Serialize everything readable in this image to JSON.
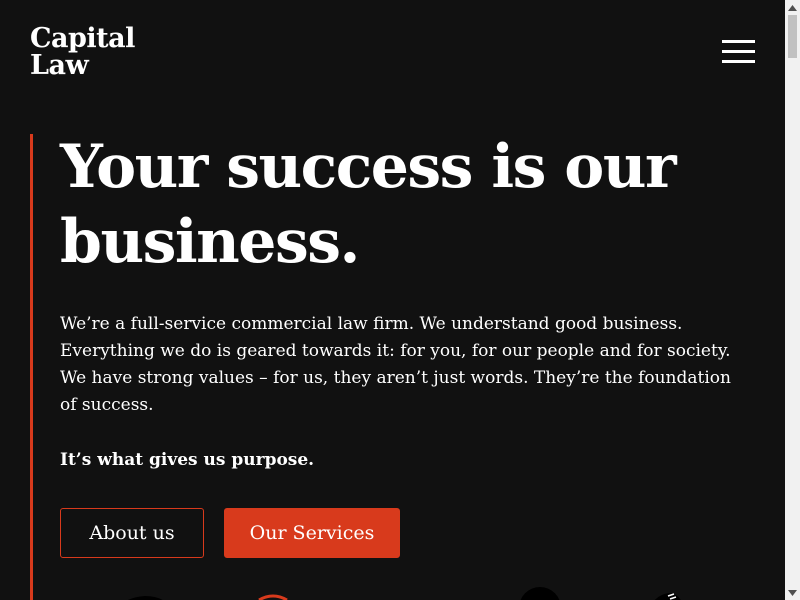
{
  "header": {
    "logo_line1": "Capital",
    "logo_line2": "Law",
    "menu_icon": "hamburger-menu-icon"
  },
  "hero": {
    "headline": "Your success is our business.",
    "intro": "We’re a full-service commercial law firm. We understand good business. Everything we do is geared towards it: for you, for our people and for society. We have strong values – for us, they aren’t just words. They’re the foundation of success.",
    "purpose": "It’s what gives us purpose.",
    "about_label": "About us",
    "services_label": "Our Services"
  },
  "colors": {
    "background": "#111111",
    "accent": "#d83a1c",
    "text": "#ffffff"
  },
  "scrollbar": {
    "up_icon": "scroll-up-arrow-icon",
    "down_icon": "scroll-down-arrow-icon"
  }
}
